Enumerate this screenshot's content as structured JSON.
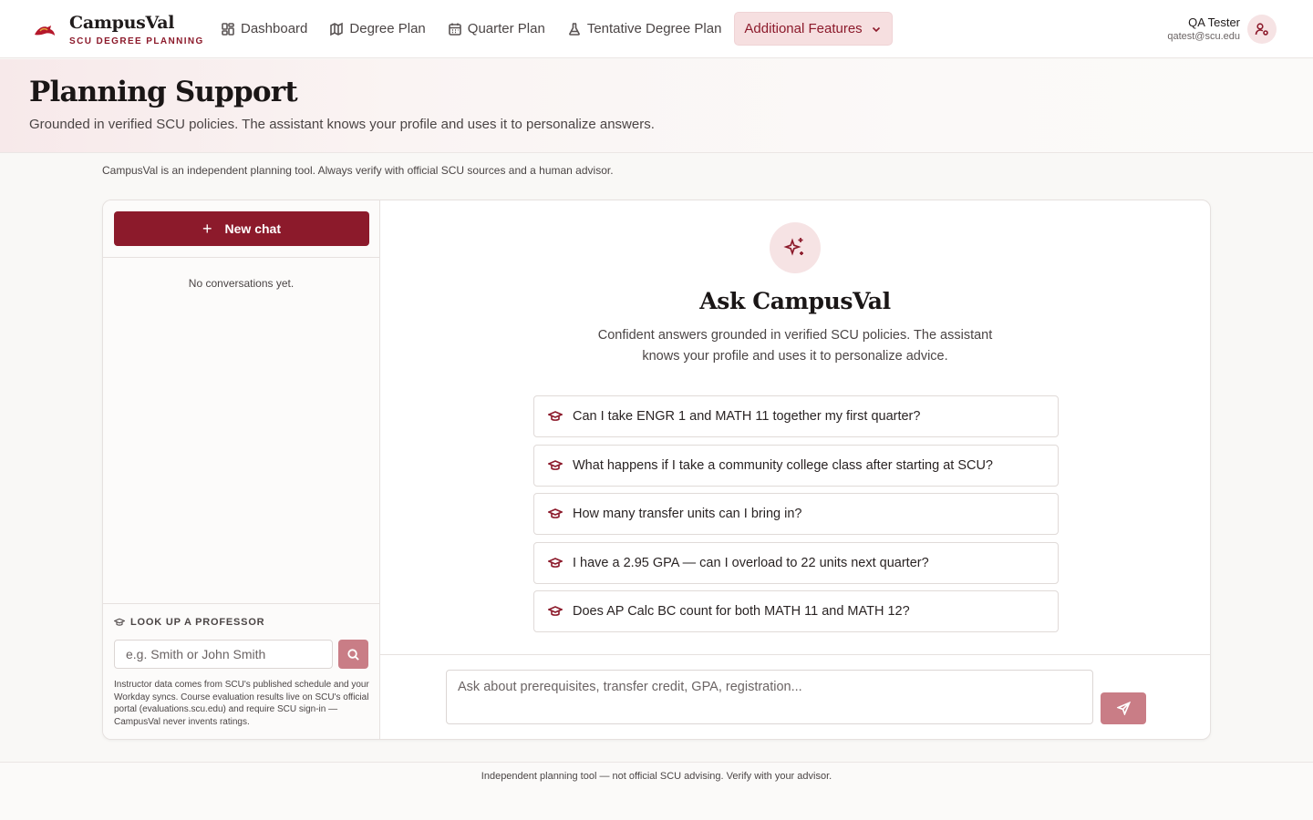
{
  "brand": {
    "name": "CampusVal",
    "tagline": "SCU DEGREE PLANNING"
  },
  "nav": {
    "items": [
      {
        "label": "Dashboard",
        "icon": "dashboard-icon"
      },
      {
        "label": "Degree Plan",
        "icon": "map-icon"
      },
      {
        "label": "Quarter Plan",
        "icon": "calendar-icon"
      },
      {
        "label": "Tentative Degree Plan",
        "icon": "flask-icon"
      }
    ],
    "dropdown": {
      "label": "Additional Features",
      "icon": "chevron-down-icon"
    }
  },
  "user": {
    "name": "QA Tester",
    "email": "qatest@scu.edu"
  },
  "page": {
    "title": "Planning Support",
    "subtitle": "Grounded in verified SCU policies. The assistant knows your profile and uses it to personalize answers."
  },
  "disclaimer": "CampusVal is an independent planning tool. Always verify with official SCU sources and a human advisor.",
  "sidebar": {
    "new_chat_label": "New chat",
    "empty_text": "No conversations yet.",
    "professor": {
      "label": "LOOK UP A PROFESSOR",
      "placeholder": "e.g. Smith or John Smith",
      "note": "Instructor data comes from SCU's published schedule and your Workday syncs. Course evaluation results live on SCU's official portal (evaluations.scu.edu) and require SCU sign-in — CampusVal never invents ratings."
    }
  },
  "chat": {
    "title": "Ask CampusVal",
    "subtitle": "Confident answers grounded in verified SCU policies. The assistant knows your profile and uses it to personalize advice.",
    "suggestions": [
      "Can I take ENGR 1 and MATH 11 together my first quarter?",
      "What happens if I take a community college class after starting at SCU?",
      "How many transfer units can I bring in?",
      "I have a 2.95 GPA — can I overload to 22 units next quarter?",
      "Does AP Calc BC count for both MATH 11 and MATH 12?"
    ],
    "input_placeholder": "Ask about prerequisites, transfer credit, GPA, registration..."
  },
  "footer": "Independent planning tool — not official SCU advising. Verify with your advisor.",
  "colors": {
    "brand": "#8c1a2b",
    "brand_muted": "#c97d86",
    "accent_bg": "#f6e3e4"
  }
}
